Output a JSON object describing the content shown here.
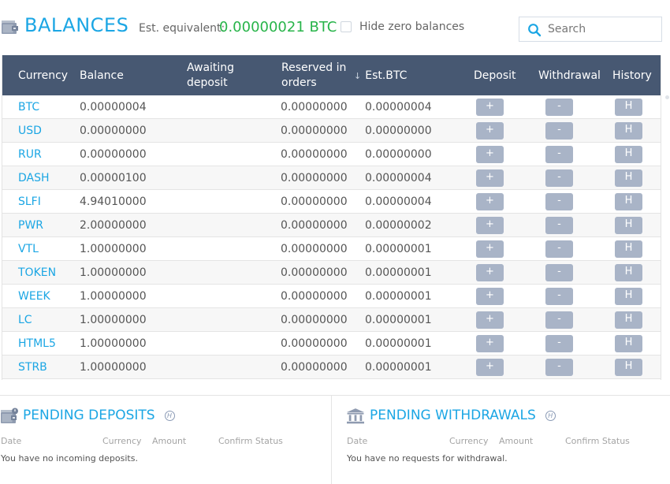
{
  "header": {
    "title": "BALANCES",
    "est_label": "Est. equivalent:",
    "est_value": "0.00000021 BTC",
    "hide_zero_label": "Hide zero balances",
    "hide_zero_checked": false,
    "search_placeholder": "Search",
    "search_value": ""
  },
  "colors": {
    "accent": "#1ba6e4",
    "estimate_green": "#28b44a",
    "table_header_bg": "#475872",
    "action_button_bg": "#a9b4c7"
  },
  "table": {
    "headers": {
      "currency": "Currency",
      "balance": "Balance",
      "awaiting": "Awaiting deposit",
      "reserved": "Reserved in orders",
      "est_btc": "Est.BTC",
      "deposit": "Deposit",
      "withdrawal": "Withdrawal",
      "history": "History"
    },
    "sort": {
      "column": "est_btc",
      "direction": "descending",
      "icon": "arrow-down"
    },
    "buttons": {
      "deposit": "+",
      "withdrawal": "-",
      "history": "H"
    },
    "rows": [
      {
        "currency": "BTC",
        "balance": "0.00000004",
        "awaiting": "",
        "reserved": "0.00000000",
        "est_btc": "0.00000004"
      },
      {
        "currency": "USD",
        "balance": "0.00000000",
        "awaiting": "",
        "reserved": "0.00000000",
        "est_btc": "0.00000000"
      },
      {
        "currency": "RUR",
        "balance": "0.00000000",
        "awaiting": "",
        "reserved": "0.00000000",
        "est_btc": "0.00000000"
      },
      {
        "currency": "DASH",
        "balance": "0.00000100",
        "awaiting": "",
        "reserved": "0.00000000",
        "est_btc": "0.00000004"
      },
      {
        "currency": "SLFI",
        "balance": "4.94010000",
        "awaiting": "",
        "reserved": "0.00000000",
        "est_btc": "0.00000004"
      },
      {
        "currency": "PWR",
        "balance": "2.00000000",
        "awaiting": "",
        "reserved": "0.00000000",
        "est_btc": "0.00000002"
      },
      {
        "currency": "VTL",
        "balance": "1.00000000",
        "awaiting": "",
        "reserved": "0.00000000",
        "est_btc": "0.00000001"
      },
      {
        "currency": "TOKEN",
        "balance": "1.00000000",
        "awaiting": "",
        "reserved": "0.00000000",
        "est_btc": "0.00000001"
      },
      {
        "currency": "WEEK",
        "balance": "1.00000000",
        "awaiting": "",
        "reserved": "0.00000000",
        "est_btc": "0.00000001"
      },
      {
        "currency": "LC",
        "balance": "1.00000000",
        "awaiting": "",
        "reserved": "0.00000000",
        "est_btc": "0.00000001"
      },
      {
        "currency": "HTML5",
        "balance": "1.00000000",
        "awaiting": "",
        "reserved": "0.00000000",
        "est_btc": "0.00000001"
      },
      {
        "currency": "STRB",
        "balance": "1.00000000",
        "awaiting": "",
        "reserved": "0.00000000",
        "est_btc": "0.00000001"
      }
    ]
  },
  "pending_deposits": {
    "title": "PENDING DEPOSITS",
    "help_glyph": "H",
    "columns": [
      "Date",
      "Currency",
      "Amount",
      "Confirm Status"
    ],
    "empty_message": "You have no incoming deposits."
  },
  "pending_withdrawals": {
    "title": "PENDING WITHDRAWALS",
    "help_glyph": "H",
    "columns": [
      "Date",
      "Currency",
      "Amount",
      "Confirm Status"
    ],
    "empty_message": "You have no requests for withdrawal."
  }
}
